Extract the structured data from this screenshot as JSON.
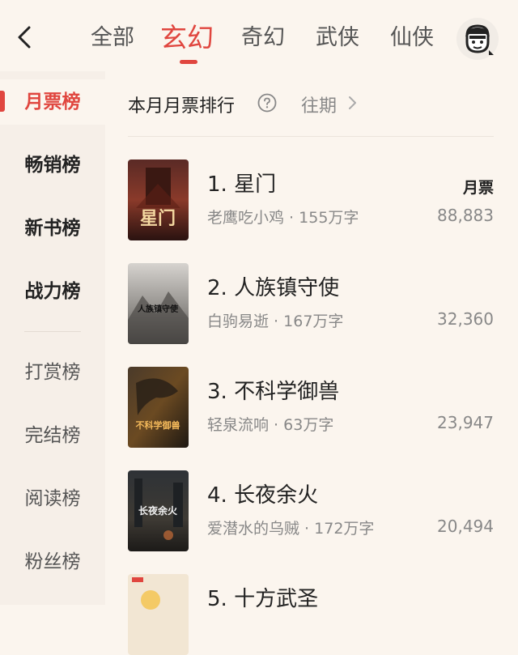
{
  "tabs": [
    {
      "label": "全部"
    },
    {
      "label": "玄幻"
    },
    {
      "label": "奇幻"
    },
    {
      "label": "武侠"
    },
    {
      "label": "仙侠"
    }
  ],
  "active_tab": "玄幻",
  "sidebar": {
    "items": [
      {
        "label": "月票榜"
      },
      {
        "label": "畅销榜"
      },
      {
        "label": "新书榜"
      },
      {
        "label": "战力榜"
      },
      {
        "label": "打赏榜"
      },
      {
        "label": "完结榜"
      },
      {
        "label": "阅读榜"
      },
      {
        "label": "粉丝榜"
      }
    ],
    "active": "月票榜"
  },
  "list_header": {
    "title": "本月月票排行",
    "past_label": "往期"
  },
  "metric_label": "月票",
  "books": [
    {
      "rank_title": "1. 星门",
      "author": "老鹰吃小鸡",
      "words": "155万字",
      "votes": "88,883",
      "cover_text": "星门"
    },
    {
      "rank_title": "2. 人族镇守使",
      "author": "白驹易逝",
      "words": "167万字",
      "votes": "32,360",
      "cover_text": "人族镇守使"
    },
    {
      "rank_title": "3. 不科学御兽",
      "author": "轻泉流响",
      "words": "63万字",
      "votes": "23,947",
      "cover_text": "不科学御兽"
    },
    {
      "rank_title": "4. 长夜余火",
      "author": "爱潜水的乌贼",
      "words": "172万字",
      "votes": "20,494",
      "cover_text": "长夜余火"
    },
    {
      "rank_title": "5. 十方武圣",
      "author": "",
      "words": "",
      "votes": "",
      "cover_text": ""
    }
  ],
  "colors": {
    "accent": "#e0463f",
    "bg": "#fbf5ee",
    "sidebar_bg": "#f6efe8"
  }
}
